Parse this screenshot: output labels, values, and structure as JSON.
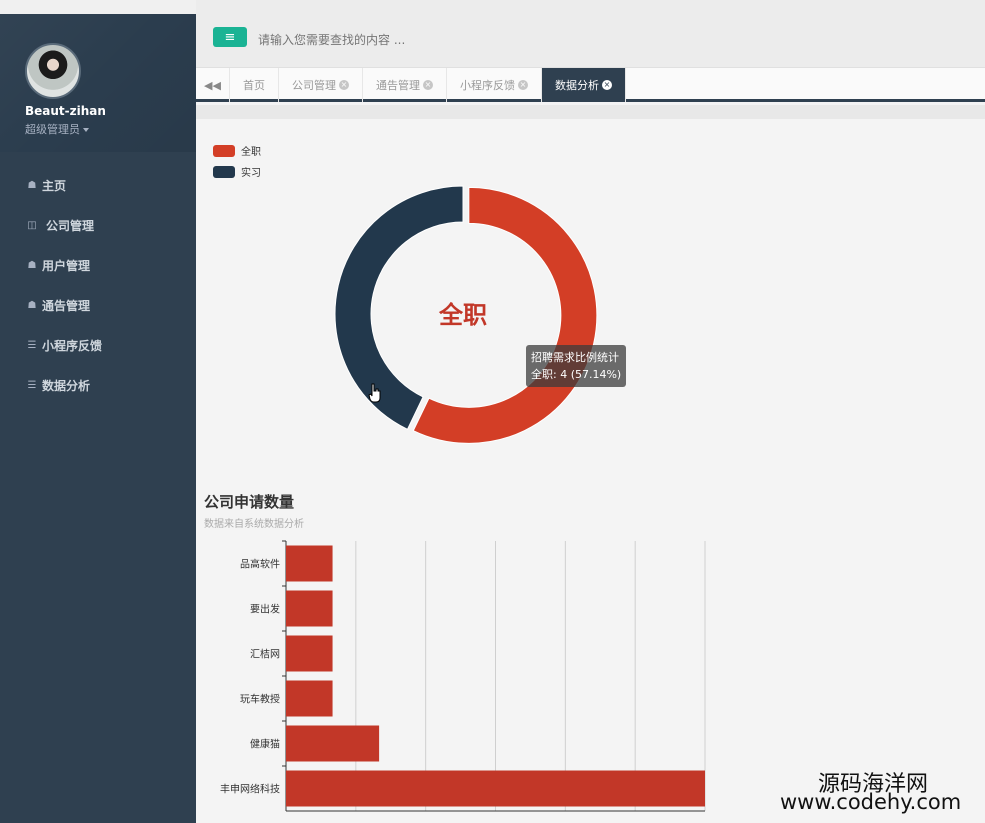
{
  "sidebar": {
    "profile": {
      "name": "Beaut-zihan",
      "role": "超级管理员"
    },
    "items": [
      {
        "label": "主页",
        "icon": "home-icon"
      },
      {
        "label": "公司管理",
        "icon": "columns-icon"
      },
      {
        "label": "用户管理",
        "icon": "home-icon"
      },
      {
        "label": "通告管理",
        "icon": "home-icon"
      },
      {
        "label": "小程序反馈",
        "icon": "list-icon"
      },
      {
        "label": "数据分析",
        "icon": "list-icon"
      }
    ]
  },
  "header": {
    "menu_icon": "hamburger-icon",
    "search_placeholder": "请输入您需要查找的内容 ..."
  },
  "tabs": [
    {
      "label": "首页",
      "closable": false,
      "active": false
    },
    {
      "label": "公司管理",
      "closable": true,
      "active": false
    },
    {
      "label": "通告管理",
      "closable": true,
      "active": false
    },
    {
      "label": "小程序反馈",
      "closable": true,
      "active": false
    },
    {
      "label": "数据分析",
      "closable": true,
      "active": true
    }
  ],
  "colors": {
    "accent": "#1ab394",
    "sidebar": "#2f4050",
    "fulltime": "#d33e26",
    "intern": "#22384c"
  },
  "chart_data": [
    {
      "type": "pie",
      "title": "",
      "center_label": "全职",
      "legend": [
        "全职",
        "实习"
      ],
      "legend_position": "top-left",
      "slices": [
        {
          "name": "全职",
          "value": 4,
          "color": "#d33e26"
        },
        {
          "name": "实习",
          "value": 3,
          "color": "#22384c"
        }
      ],
      "tooltip": {
        "title": "招聘需求比例统计",
        "text": "全职: 4 (57.14%)"
      }
    },
    {
      "type": "bar",
      "orientation": "horizontal",
      "title": "公司申请数量",
      "subtitle": "数据来自系统数据分析",
      "categories": [
        "品高软件",
        "要出发",
        "汇桔网",
        "玩车教授",
        "健康猫",
        "丰申网络科技"
      ],
      "values": [
        1,
        1,
        1,
        1,
        2,
        9
      ],
      "xlim": [
        0,
        9
      ],
      "grid": true,
      "color": "#c23728"
    }
  ],
  "watermark": {
    "line1": "源码海洋网",
    "line2": "www.codehy.com"
  }
}
